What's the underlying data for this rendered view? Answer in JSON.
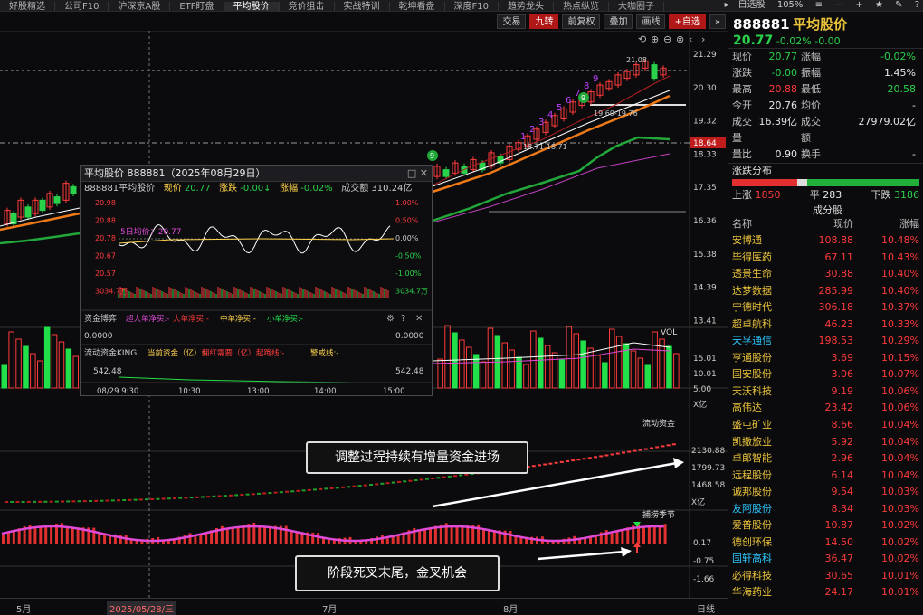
{
  "top_tabs": [
    "好股精选",
    "公司F10",
    "沪深京A股",
    "ETF盯盘",
    "平均股价",
    "竞价狙击",
    "实战特训",
    "乾坤看盘",
    "深度F10",
    "趋势龙头",
    "热点纵览",
    "大咖圈子"
  ],
  "top_right": {
    "fav": "自选股",
    "zoom": "105%",
    "icons": [
      "≡",
      "—",
      "+",
      "★",
      "✎",
      "?"
    ]
  },
  "toolbar": {
    "buttons": [
      "交易",
      "九转",
      "前复权",
      "叠加",
      "画线",
      "+自选"
    ],
    "more": "»"
  },
  "price_axis": [
    "21.29",
    "20.30",
    "19.32",
    "18.33",
    "17.35",
    "16.36",
    "15.38",
    "14.39",
    "13.41"
  ],
  "price_tag": "18.64",
  "chart_annot": {
    "high": "21.08",
    "low": "18.71-18.71",
    "mid": "19.69-19.76",
    "nine_count": [
      "1",
      "2",
      "3",
      "4",
      "5",
      "6",
      "7",
      "8",
      "9"
    ]
  },
  "vol_axis": {
    "label": "VOL",
    "ticks": [
      "15.01",
      "10.01",
      "5.00",
      "X亿"
    ]
  },
  "flow_axis": {
    "label": "流动资金",
    "ticks": [
      "2130.88",
      "1799.73",
      "1468.58",
      "X亿"
    ]
  },
  "season_axis": {
    "label": "捕捞季节",
    "ticks": [
      "0.17",
      "-0.75",
      "-1.66"
    ]
  },
  "notes": {
    "top": "调整过程持续有增量资金进场",
    "bottom": "阶段死叉末尾，金叉机会"
  },
  "date_axis": [
    "5月",
    "2025/05/28/三",
    "7月",
    "8月",
    "日线"
  ],
  "popup": {
    "title": "平均股价 888881（2025年08月29日）",
    "ctl": "□ ✕",
    "row": {
      "code": "888881平均股价",
      "now_lbl": "现价",
      "now": "20.77",
      "chg_lbl": "涨跌",
      "chg": "-0.00↓",
      "pct_lbl": "涨幅",
      "pct": "-0.02%",
      "amt_lbl": "成交额",
      "amt": "310.24亿"
    },
    "left_ticks": [
      "20.98",
      "20.88",
      "20.78",
      "20.67",
      "20.57",
      "3034.7万"
    ],
    "right_ticks": [
      "1.00%",
      "0.50%",
      "0.00%",
      "-0.50%",
      "-1.00%",
      "3034.7万"
    ],
    "avg_label": "5日均价：20.77",
    "fund_title": "资金博弈",
    "fund_items": [
      "超大单净买:-",
      "大单净买:-",
      "中单净买:-",
      "小单净买:-"
    ],
    "fund_val": "0.0000",
    "king_title": "流动资金KING",
    "king_items": [
      "当前资金（亿）:-",
      "翻红需要（亿）:-",
      "起跑线:-",
      "警戒线:-"
    ],
    "king_val": "542.48",
    "time_ticks": [
      "08/29 9:30",
      "10:30",
      "13:00",
      "14:00",
      "15:00"
    ]
  },
  "right": {
    "code": "888881",
    "name": "平均股价",
    "price": "20.77",
    "pct": "-0.02%",
    "chg": "-0.00",
    "stats": [
      [
        "现价",
        "20.77",
        "涨幅",
        "-0.02%"
      ],
      [
        "涨跌",
        "-0.00",
        "振幅",
        "1.45%"
      ],
      [
        "最高",
        "20.88",
        "最低",
        "20.58"
      ],
      [
        "今开",
        "20.76",
        "均价",
        "-"
      ],
      [
        "成交量",
        "16.39亿",
        "成交额",
        "27979.02亿"
      ],
      [
        "量比",
        "0.90",
        "换手",
        "-"
      ]
    ],
    "dist_title": "涨跌分布",
    "dist": {
      "up_lbl": "上涨",
      "up": "1850",
      "flat_lbl": "平",
      "flat": "283",
      "down_lbl": "下跌",
      "down": "3186"
    },
    "comp_title": "成分股",
    "comp_hdr": [
      "名称",
      "现价",
      "涨幅"
    ],
    "comp": [
      [
        "安博通",
        "108.88",
        "10.48%"
      ],
      [
        "毕得医药",
        "67.11",
        "10.43%"
      ],
      [
        "透景生命",
        "30.88",
        "10.40%"
      ],
      [
        "达梦数据",
        "285.99",
        "10.40%"
      ],
      [
        "宁德时代",
        "306.18",
        "10.37%"
      ],
      [
        "超卓航科",
        "46.23",
        "10.33%"
      ],
      [
        "天孚通信",
        "198.53",
        "10.29%"
      ],
      [
        "亨通股份",
        "3.69",
        "10.15%"
      ],
      [
        "国安股份",
        "3.06",
        "10.07%"
      ],
      [
        "天沃科技",
        "9.19",
        "10.06%"
      ],
      [
        "高伟达",
        "23.42",
        "10.06%"
      ],
      [
        "盛屯矿业",
        "8.66",
        "10.04%"
      ],
      [
        "凯撒旅业",
        "5.92",
        "10.04%"
      ],
      [
        "卓郎智能",
        "2.96",
        "10.04%"
      ],
      [
        "远程股份",
        "6.14",
        "10.04%"
      ],
      [
        "诚邦股份",
        "9.54",
        "10.03%"
      ],
      [
        "友阿股份",
        "8.34",
        "10.03%"
      ],
      [
        "爱普股份",
        "10.87",
        "10.02%"
      ],
      [
        "德创环保",
        "14.50",
        "10.02%"
      ],
      [
        "国轩高科",
        "36.47",
        "10.02%"
      ],
      [
        "必得科技",
        "30.65",
        "10.01%"
      ],
      [
        "华海药业",
        "24.17",
        "10.01%"
      ]
    ],
    "cyan_names": [
      "天孚通信",
      "友阿股份",
      "国轩高科"
    ]
  }
}
